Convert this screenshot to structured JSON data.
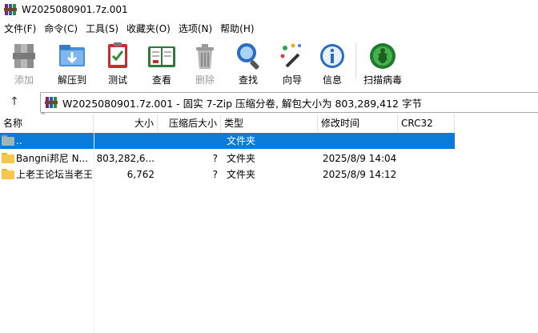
{
  "window": {
    "title": "W2025080901.7z.001"
  },
  "menu": [
    "文件(F)",
    "命令(C)",
    "工具(S)",
    "收藏夹(O)",
    "选项(N)",
    "帮助(H)"
  ],
  "toolbar": [
    {
      "label": "添加",
      "icon": "add-archive-icon",
      "disabled": true
    },
    {
      "label": "解压到",
      "icon": "extract-to-icon",
      "disabled": false
    },
    {
      "label": "测试",
      "icon": "test-icon",
      "disabled": false
    },
    {
      "label": "查看",
      "icon": "view-book-icon",
      "disabled": false
    },
    {
      "label": "删除",
      "icon": "trash-icon",
      "disabled": true
    },
    {
      "label": "查找",
      "icon": "magnifier-icon",
      "disabled": false
    },
    {
      "label": "向导",
      "icon": "wizard-wand-icon",
      "disabled": false
    },
    {
      "label": "信息",
      "icon": "info-icon",
      "disabled": false
    },
    {
      "label": "扫描病毒",
      "icon": "virus-scan-icon",
      "disabled": false
    }
  ],
  "address": {
    "path": "W2025080901.7z.001 - 固实 7-Zip 压缩分卷, 解包大小为 803,289,412 字节"
  },
  "columns": [
    "名称",
    "大小",
    "压缩后大小",
    "类型",
    "修改时间",
    "CRC32"
  ],
  "rows": [
    {
      "name": "..",
      "size": "",
      "packed": "",
      "type": "文件夹",
      "modified": "",
      "crc": "",
      "selected": true
    },
    {
      "name": "Bangni邦尼 N...",
      "size": "803,282,6...",
      "packed": "?",
      "type": "文件夹",
      "modified": "2025/8/9 14:04",
      "crc": "",
      "selected": false
    },
    {
      "name": "上老王论坛当老王",
      "size": "6,762",
      "packed": "?",
      "type": "文件夹",
      "modified": "2025/8/9 14:12",
      "crc": "",
      "selected": false
    }
  ],
  "colors": {
    "selection": "#0a7bd8",
    "folder": "#f5c84c"
  }
}
